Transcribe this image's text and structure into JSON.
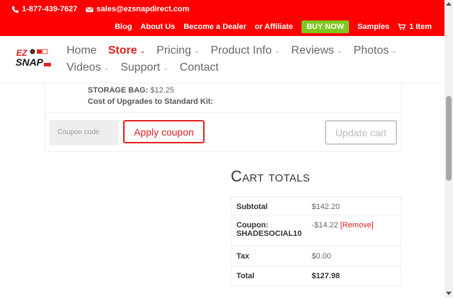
{
  "topbar": {
    "phone": "1-877-439-7627",
    "email": "sales@ezsnapdirect.com",
    "links": [
      "Blog",
      "About Us",
      "Become a Dealer",
      "or Affiliate"
    ],
    "buy_now": "BUY NOW",
    "samples": "Samples",
    "cart": "1 Item",
    "bg_color": "#ff0000",
    "buy_color": "#7cc81c"
  },
  "logo": {
    "line1": "EZ",
    "line2": "SNAP"
  },
  "nav": {
    "items": [
      "Home",
      "Store",
      "Pricing",
      "Product Info",
      "Reviews",
      "Photos",
      "Videos",
      "Support",
      "Contact"
    ],
    "active": "Store",
    "accent": "#e02020"
  },
  "cart": {
    "storage_bag_label": "STORAGE BAG:",
    "storage_bag_value": "$12.25",
    "upgrade_cost_label": "Cost of Upgrades to Standard Kit:",
    "coupon_placeholder": "Coupon code",
    "apply_coupon": "Apply coupon",
    "update_cart": "Update cart"
  },
  "totals": {
    "title": "Cart totals",
    "subtotal_label": "Subtotal",
    "subtotal_value": "$142.20",
    "coupon_label": "Coupon: SHADESOCIAL10",
    "coupon_value": "-$14.22",
    "remove_label": "[Remove]",
    "tax_label": "Tax",
    "tax_value": "$0.00",
    "total_label": "Total",
    "total_value": "$127.98"
  }
}
